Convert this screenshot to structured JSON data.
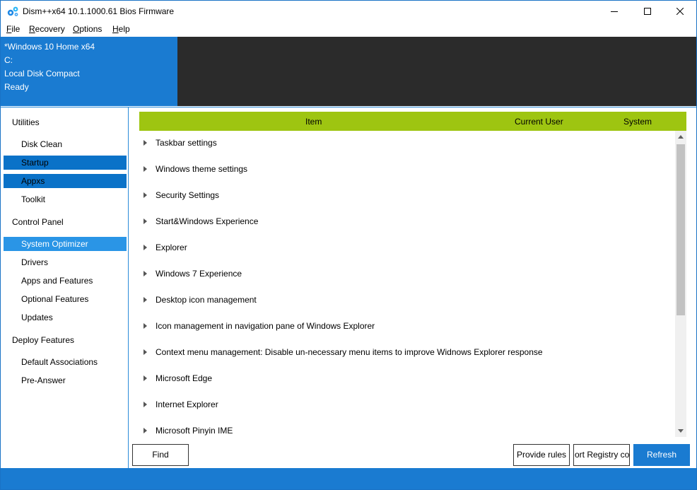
{
  "window": {
    "title": "Dism++x64 10.1.1000.61 Bios Firmware",
    "icon": "gear-cluster-icon",
    "controls": {
      "minimize": "minimize-icon",
      "maximize": "maximize-icon",
      "close": "close-icon"
    }
  },
  "menu": {
    "file": {
      "u": "F",
      "rest": "ile"
    },
    "recovery": {
      "u": "R",
      "rest": "ecovery"
    },
    "options": {
      "u": "O",
      "rest": "ptions"
    },
    "help": {
      "u": "H",
      "rest": "elp"
    }
  },
  "info": {
    "os": "*Windows 10 Home x64",
    "drive": "C:",
    "disk": "Local Disk Compact",
    "status": "Ready"
  },
  "sidebar": {
    "utilities": "Utilities",
    "disk_clean": "Disk Clean",
    "startup": "Startup",
    "appxs": "Appxs",
    "toolkit": "Toolkit",
    "control_panel": "Control Panel",
    "system_optimizer": "System Optimizer",
    "drivers": "Drivers",
    "apps_and_features": "Apps and Features",
    "optional_features": "Optional Features",
    "updates": "Updates",
    "deploy_features": "Deploy Features",
    "default_associations": "Default Associations",
    "pre_answer": "Pre-Answer"
  },
  "grid": {
    "columns": {
      "item": "Item",
      "current_user": "Current User",
      "system": "System"
    },
    "rows": [
      "Taskbar settings",
      "Windows theme settings",
      "Security Settings",
      "Start&Windows Experience",
      "Explorer",
      "Windows 7 Experience",
      "Desktop icon management",
      "Icon management in navigation pane of Windows Explorer",
      "Context menu management: Disable un-necessary menu items to improve Widnows Explorer response",
      "Microsoft Edge",
      "Internet Explorer",
      "Microsoft Pinyin IME"
    ]
  },
  "buttons": {
    "find": "Find",
    "provide_rules": "Provide rules",
    "export_registry": "ort Registry co",
    "refresh": "Refresh"
  },
  "colors": {
    "accent": "#1a7bd1",
    "header_green": "#9ec511",
    "dark_panel": "#2b2b2b",
    "selected_dark": "#0a72c8",
    "selected_light": "#2a95e6"
  }
}
